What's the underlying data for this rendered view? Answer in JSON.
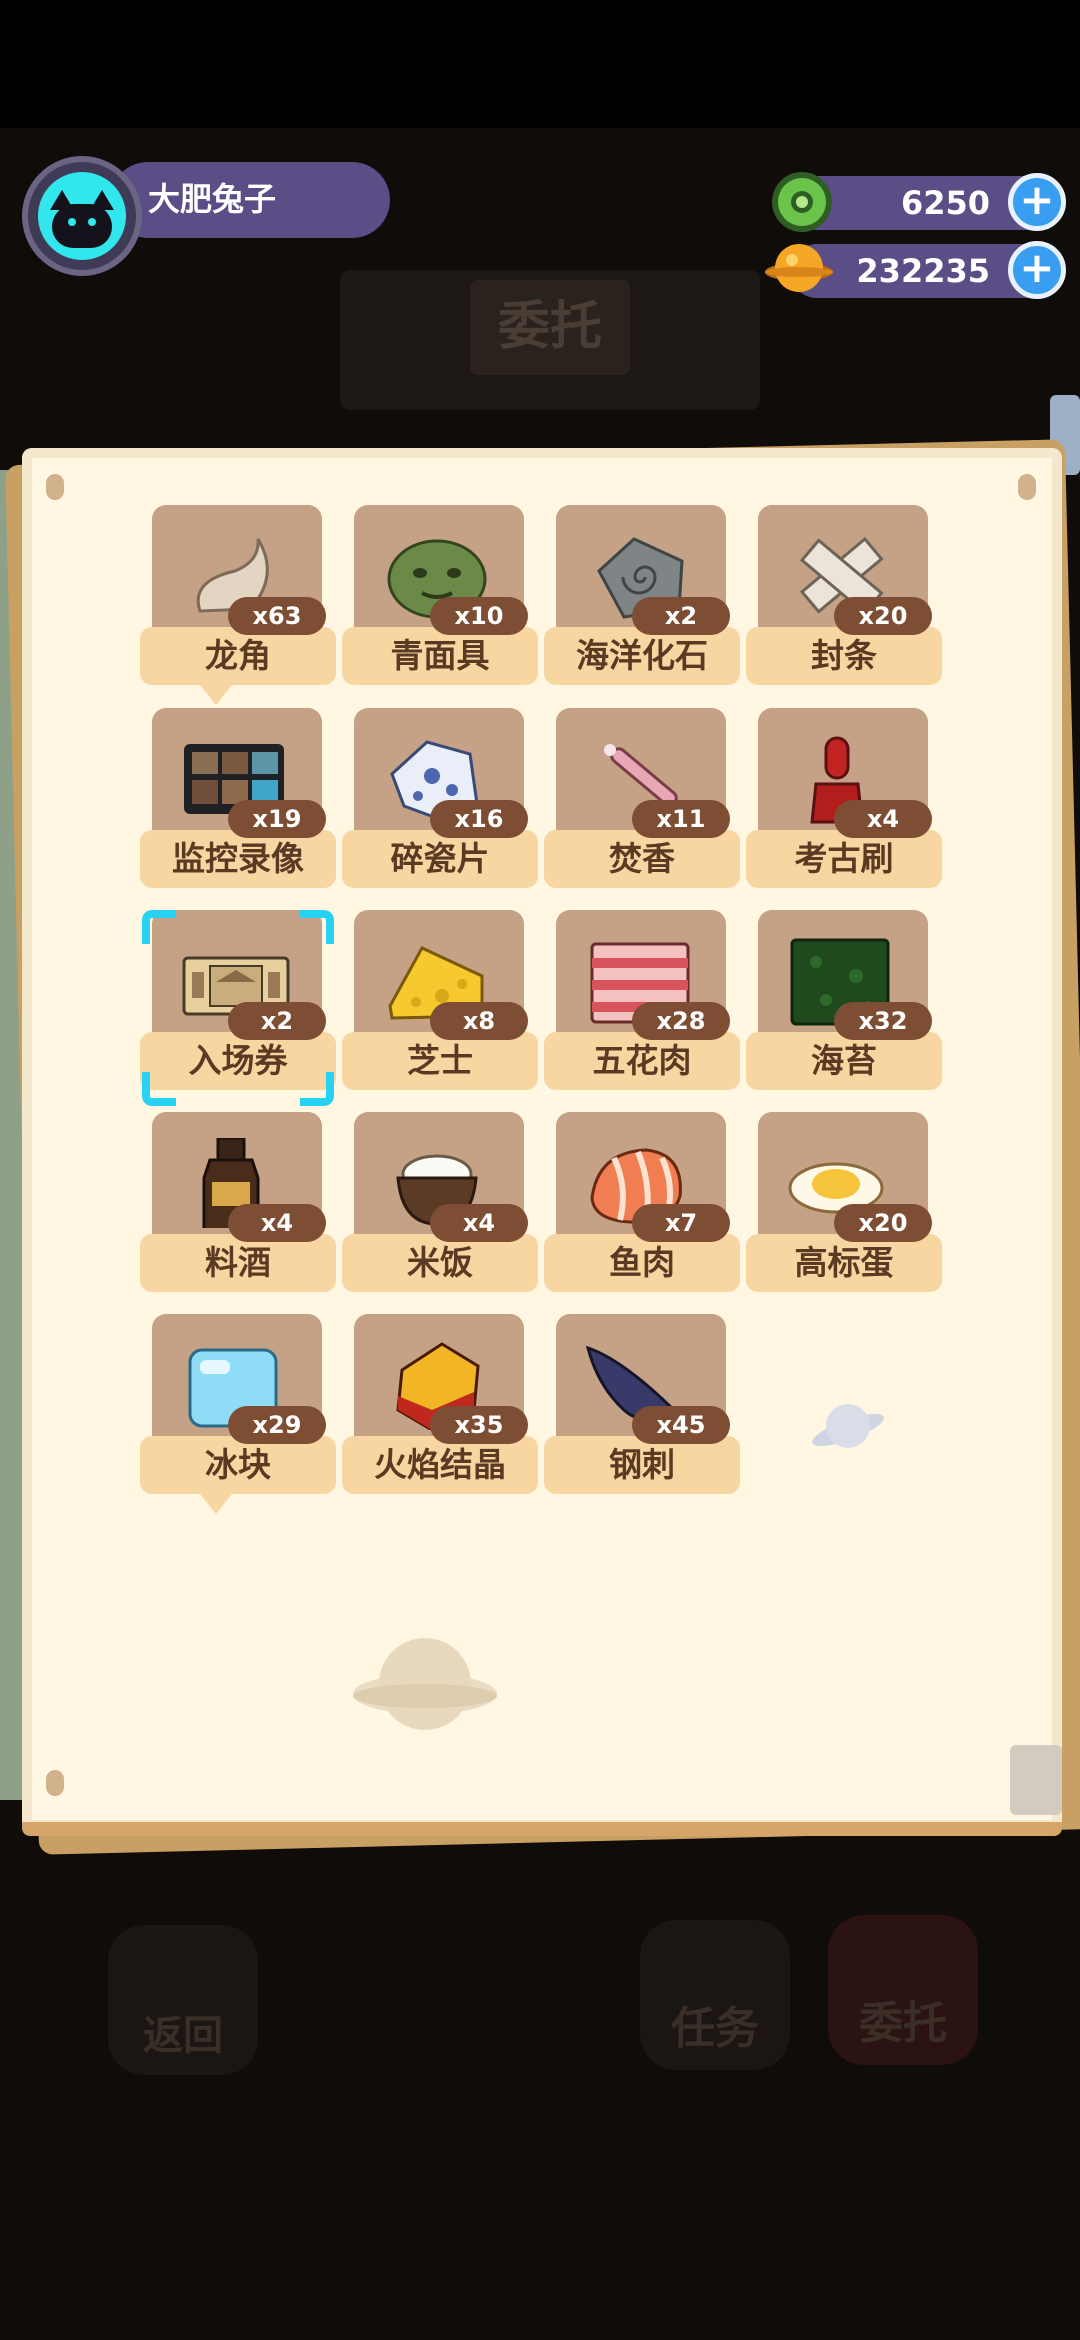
{
  "player": {
    "name": "大肥兔子"
  },
  "currencies": [
    {
      "name": "green-coin",
      "value": "6250",
      "color": "#6ac44a"
    },
    {
      "name": "gold-planet",
      "value": "232235",
      "color": "#f4a626"
    }
  ],
  "background": {
    "sign_text": "委托",
    "buttons": [
      "返回",
      "任务",
      "委托"
    ]
  },
  "items": [
    {
      "name": "龙角",
      "count": "x63",
      "icon": "horn-icon"
    },
    {
      "name": "青面具",
      "count": "x10",
      "icon": "mask-icon"
    },
    {
      "name": "海洋化石",
      "count": "x2",
      "icon": "fossil-icon"
    },
    {
      "name": "封条",
      "count": "x20",
      "icon": "seal-strip-icon"
    },
    {
      "name": "监控录像",
      "count": "x19",
      "icon": "cctv-icon"
    },
    {
      "name": "碎瓷片",
      "count": "x16",
      "icon": "porcelain-shard-icon"
    },
    {
      "name": "焚香",
      "count": "x11",
      "icon": "incense-icon"
    },
    {
      "name": "考古刷",
      "count": "x4",
      "icon": "brush-icon"
    },
    {
      "name": "入场券",
      "count": "x2",
      "icon": "ticket-icon",
      "selected": true
    },
    {
      "name": "芝士",
      "count": "x8",
      "icon": "cheese-icon"
    },
    {
      "name": "五花肉",
      "count": "x28",
      "icon": "pork-belly-icon"
    },
    {
      "name": "海苔",
      "count": "x32",
      "icon": "seaweed-icon"
    },
    {
      "name": "料酒",
      "count": "x4",
      "icon": "wine-bottle-icon"
    },
    {
      "name": "米饭",
      "count": "x4",
      "icon": "rice-bowl-icon"
    },
    {
      "name": "鱼肉",
      "count": "x7",
      "icon": "fish-meat-icon"
    },
    {
      "name": "高标蛋",
      "count": "x20",
      "icon": "egg-icon"
    },
    {
      "name": "冰块",
      "count": "x29",
      "icon": "ice-cube-icon"
    },
    {
      "name": "火焰结晶",
      "count": "x35",
      "icon": "fire-crystal-icon"
    },
    {
      "name": "钢刺",
      "count": "x45",
      "icon": "steel-spike-icon"
    }
  ]
}
